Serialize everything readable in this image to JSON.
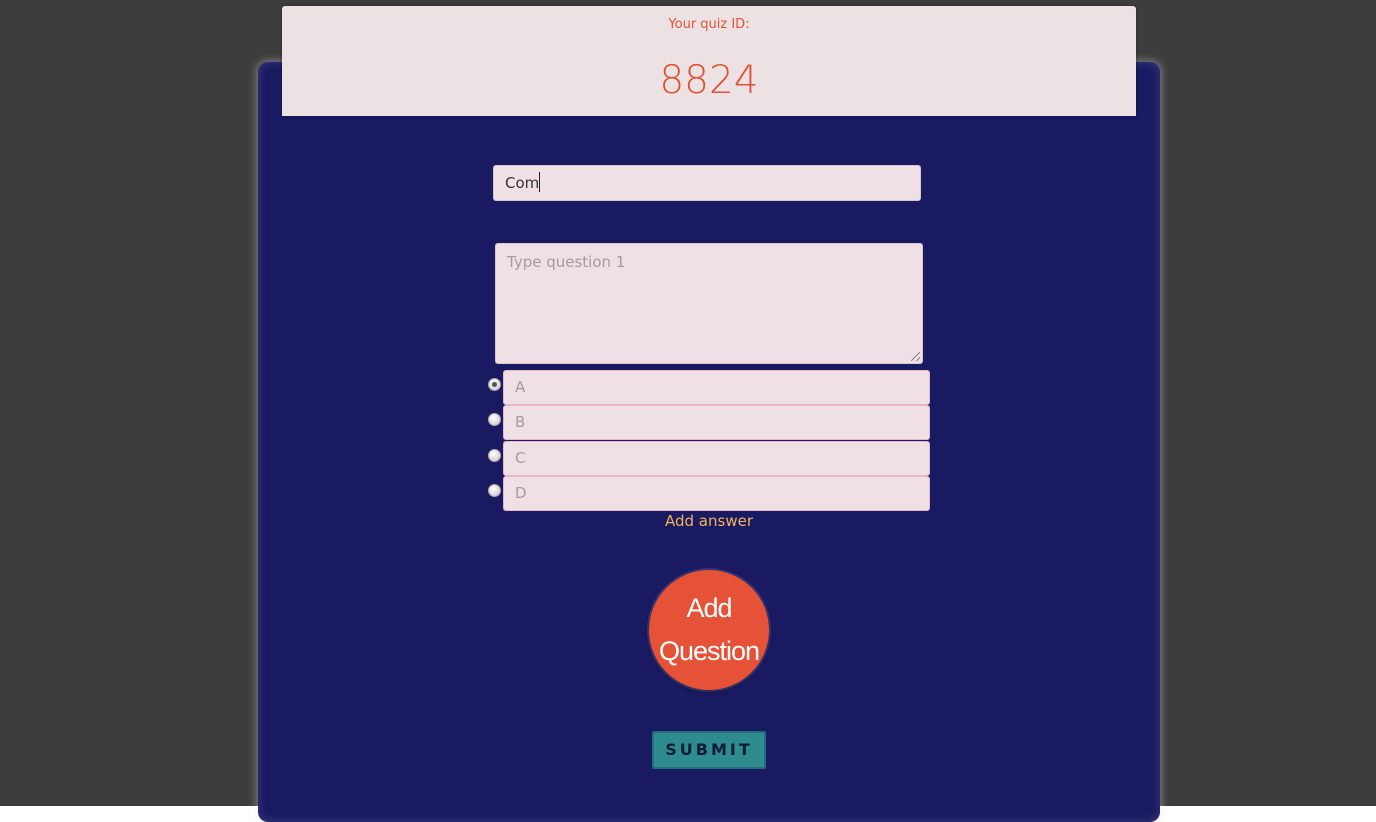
{
  "quiz": {
    "id_label": "Your quiz ID:",
    "id_value": "8824"
  },
  "form": {
    "title_value": "Com",
    "question_placeholder": "Type question 1",
    "answers": [
      {
        "placeholder": "A",
        "selected": true
      },
      {
        "placeholder": "B",
        "selected": false
      },
      {
        "placeholder": "C",
        "selected": false
      },
      {
        "placeholder": "D",
        "selected": false
      }
    ],
    "add_answer_label": "Add answer",
    "add_question_line1": "Add",
    "add_question_line2": "Question",
    "submit_label": "SUBMIT"
  },
  "colors": {
    "page_background": "#3d3d3d",
    "panel": "#1a1a62",
    "accent": "#e55237",
    "link": "#f2b25f",
    "submit": "#2e8c8f",
    "input_background": "#efe0e5"
  }
}
